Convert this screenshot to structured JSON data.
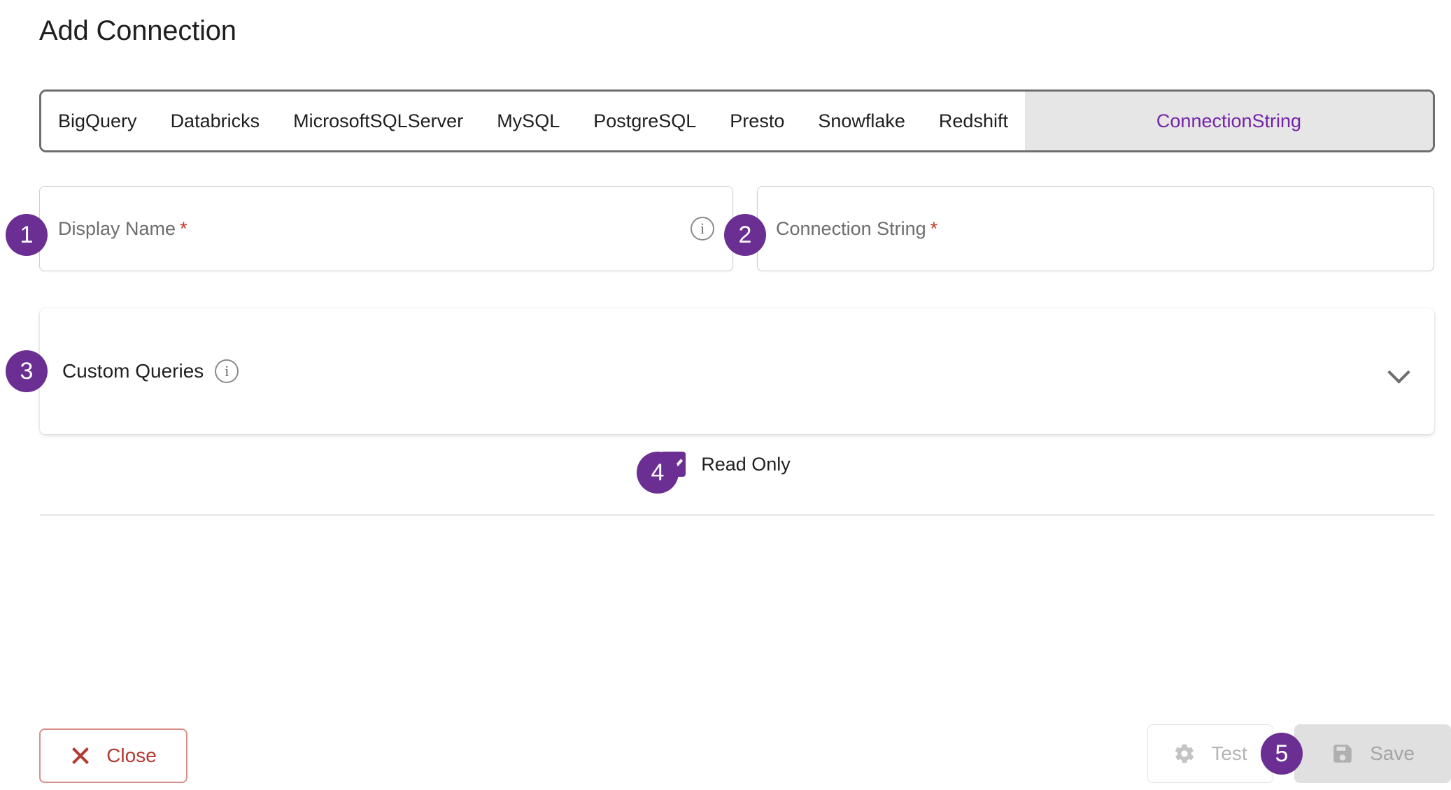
{
  "page_title": "Add Connection",
  "tabs": [
    {
      "label": "BigQuery",
      "active": false
    },
    {
      "label": "Databricks",
      "active": false
    },
    {
      "label": "MicrosoftSQLServer",
      "active": false
    },
    {
      "label": "MySQL",
      "active": false
    },
    {
      "label": "PostgreSQL",
      "active": false
    },
    {
      "label": "Presto",
      "active": false
    },
    {
      "label": "Snowflake",
      "active": false
    },
    {
      "label": "Redshift",
      "active": false
    },
    {
      "label": "ConnectionString",
      "active": true
    }
  ],
  "fields": {
    "display_name": {
      "placeholder": "Display Name",
      "value": "",
      "required_marker": "*",
      "info_icon": "info-icon",
      "info_glyph": "i"
    },
    "connection_string": {
      "placeholder": "Connection String",
      "value": "",
      "required_marker": "*"
    }
  },
  "custom_queries": {
    "label": "Custom Queries",
    "info_icon": "info-icon",
    "info_glyph": "i",
    "expand_icon": "chevron-down-icon",
    "expanded": false
  },
  "read_only": {
    "label": "Read Only",
    "checked": true
  },
  "footer": {
    "close": {
      "label": "Close",
      "icon": "close-x-icon",
      "enabled": true
    },
    "test": {
      "label": "Test",
      "icon": "gear-icon",
      "enabled": false
    },
    "save": {
      "label": "Save",
      "icon": "floppy-disk-icon",
      "enabled": false
    }
  },
  "step_badges": [
    {
      "number": "1",
      "target": "display-name-field"
    },
    {
      "number": "2",
      "target": "connection-string-field"
    },
    {
      "number": "3",
      "target": "custom-queries-panel"
    },
    {
      "number": "4",
      "target": "read-only-checkbox"
    },
    {
      "number": "5",
      "target": "save-button"
    }
  ],
  "colors": {
    "accent_purple": "#6b2f93",
    "active_tab_text": "#7423a8",
    "active_tab_bg": "#e6e6e6",
    "required_red": "#c0392b",
    "close_red": "#b33a32",
    "disabled_gray": "#a5a5a5",
    "border_gray": "#6e6e6e"
  }
}
